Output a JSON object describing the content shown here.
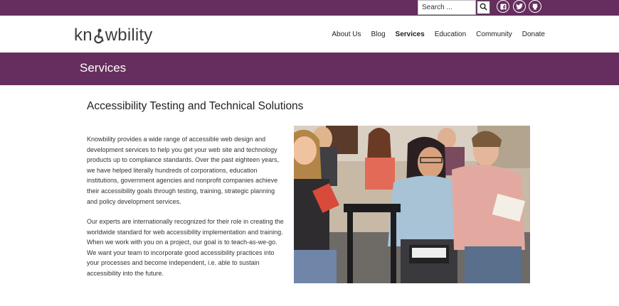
{
  "search": {
    "placeholder": "Search ..."
  },
  "social": [
    {
      "icon": "facebook-icon",
      "label": "f"
    },
    {
      "icon": "twitter-icon",
      "label": "t"
    },
    {
      "icon": "github-icon",
      "label": "gh"
    }
  ],
  "logo": {
    "text_before": "kn",
    "text_after": "wbility"
  },
  "nav": {
    "items": [
      "About Us",
      "Blog",
      "Services",
      "Education",
      "Community",
      "Donate"
    ],
    "active": "Services"
  },
  "banner": {
    "title": "Services"
  },
  "main": {
    "heading": "Accessibility Testing and Technical Solutions",
    "paragraph1": "Knowbility provides a wide range of accessible web design and development services to help you get your web site and technology products up to compliance standards. Over the past eighteen years, we have helped literally hundreds of corporations, education institutions, government agencies and nonprofit companies achieve their accessibility goals through testing, training, strategic planning and policy development services.",
    "paragraph2": "Our experts are internationally recognized for their role in creating the worldwide standard for web accessibility implementation and training. When we work with you on a project, our goal is to teach-as-we-go. We want your team to incorporate good accessibility practices into your processes and become independent, i.e. able to sustain accessibility into the future."
  },
  "colors": {
    "brand": "#662e5e",
    "text": "#222222",
    "background": "#ffffff"
  }
}
